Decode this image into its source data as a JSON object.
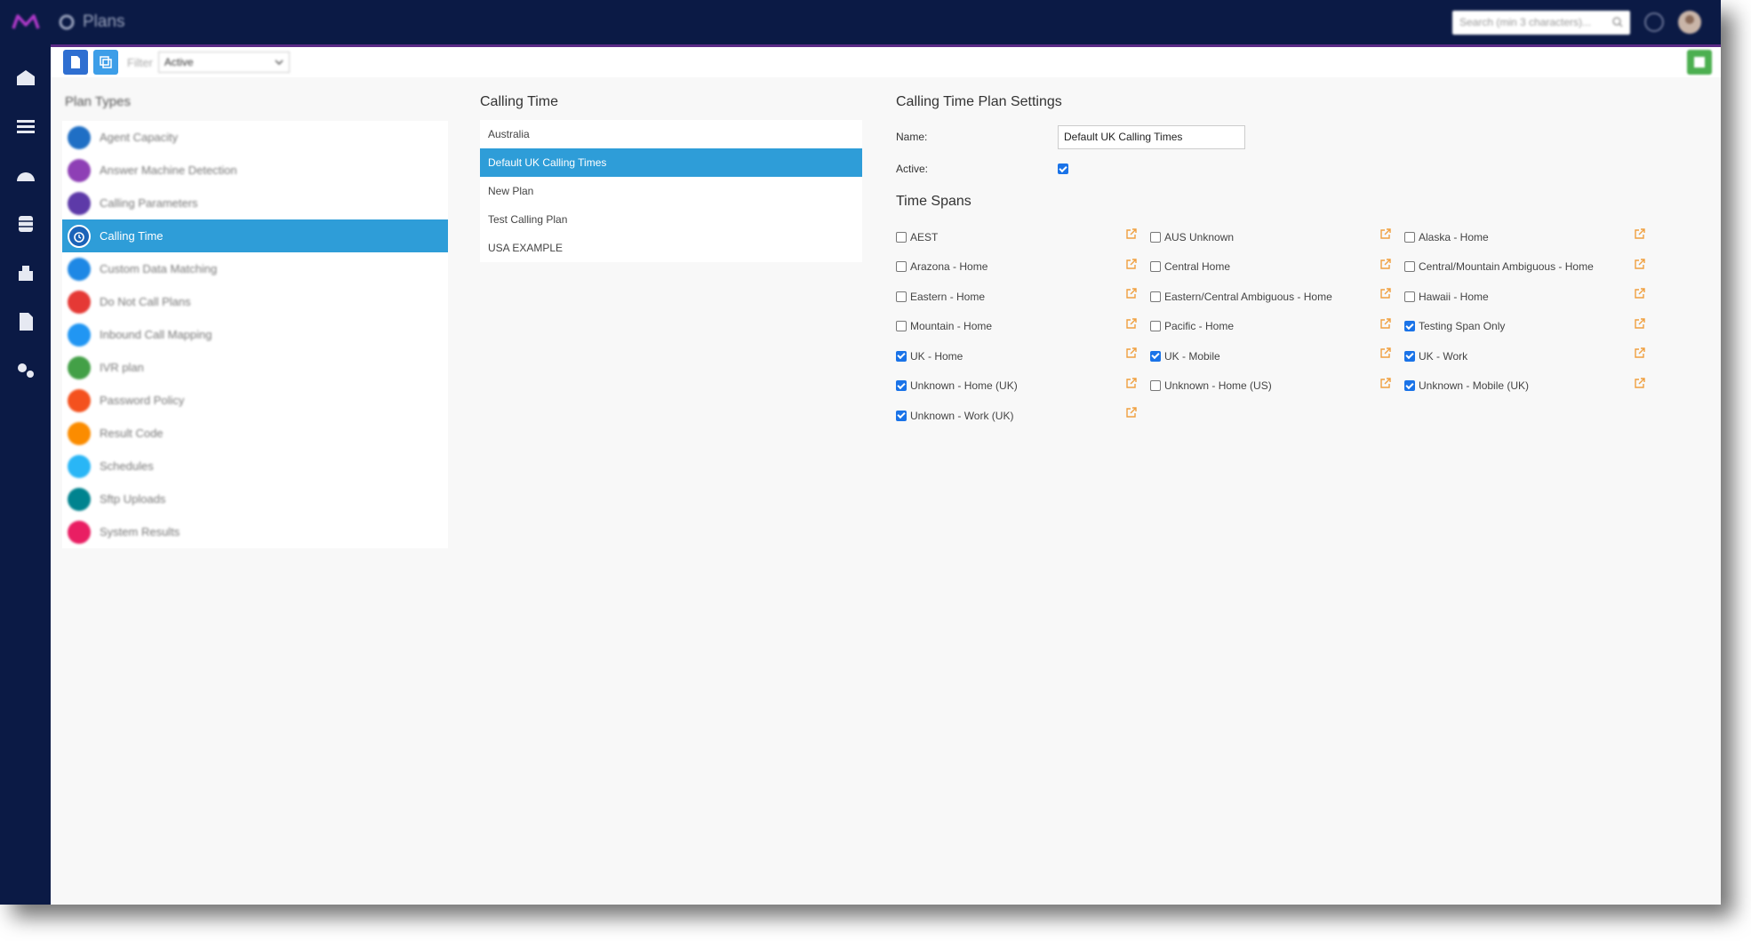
{
  "topbar": {
    "title": "Plans",
    "search_placeholder": "Search (min 3 characters)..."
  },
  "toolbar": {
    "filter_label": "Filter",
    "filter_value": "Active"
  },
  "plan_types": {
    "title": "Plan Types",
    "items": [
      {
        "label": "Agent Capacity",
        "color": "#1f6fc5"
      },
      {
        "label": "Answer Machine Detection",
        "color": "#8e3fb5"
      },
      {
        "label": "Calling Parameters",
        "color": "#5d3aa8"
      },
      {
        "label": "Calling Time",
        "color": "#1b63b8"
      },
      {
        "label": "Custom Data Matching",
        "color": "#1e88e5"
      },
      {
        "label": "Do Not Call Plans",
        "color": "#e53935"
      },
      {
        "label": "Inbound Call Mapping",
        "color": "#2196f3"
      },
      {
        "label": "IVR plan",
        "color": "#43a047"
      },
      {
        "label": "Password Policy",
        "color": "#f4511e"
      },
      {
        "label": "Result Code",
        "color": "#fb8c00"
      },
      {
        "label": "Schedules",
        "color": "#29b6f6"
      },
      {
        "label": "Sftp Uploads",
        "color": "#00838f"
      },
      {
        "label": "System Results",
        "color": "#e91e63"
      }
    ],
    "active_index": 3
  },
  "calling_time": {
    "title": "Calling Time",
    "plans": [
      "Australia",
      "Default UK Calling Times",
      "New Plan",
      "Test Calling Plan",
      "USA EXAMPLE"
    ],
    "active_index": 1
  },
  "settings": {
    "title": "Calling Time Plan Settings",
    "name_label": "Name:",
    "name_value": "Default UK Calling Times",
    "active_label": "Active:",
    "active_checked": true,
    "spans_title": "Time Spans",
    "spans": [
      {
        "label": "AEST",
        "checked": false
      },
      {
        "label": "AUS Unknown",
        "checked": false
      },
      {
        "label": "Alaska - Home",
        "checked": false
      },
      {
        "label": "Arazona - Home",
        "checked": false
      },
      {
        "label": "Central Home",
        "checked": false
      },
      {
        "label": "Central/Mountain Ambiguous - Home",
        "checked": false
      },
      {
        "label": "Eastern - Home",
        "checked": false
      },
      {
        "label": "Eastern/Central Ambiguous - Home",
        "checked": false
      },
      {
        "label": "Hawaii - Home",
        "checked": false
      },
      {
        "label": "Mountain - Home",
        "checked": false
      },
      {
        "label": "Pacific - Home",
        "checked": false
      },
      {
        "label": "Testing Span Only",
        "checked": true
      },
      {
        "label": "UK - Home",
        "checked": true
      },
      {
        "label": "UK - Mobile",
        "checked": true
      },
      {
        "label": "UK - Work",
        "checked": true
      },
      {
        "label": "Unknown - Home (UK)",
        "checked": true
      },
      {
        "label": "Unknown - Home (US)",
        "checked": false
      },
      {
        "label": "Unknown - Mobile (UK)",
        "checked": true
      },
      {
        "label": "Unknown - Work (UK)",
        "checked": true
      }
    ]
  },
  "colors": {
    "nav_bg": "#0b1a45",
    "accent": "#2e9dd8",
    "edit_icon": "#f0a040"
  }
}
